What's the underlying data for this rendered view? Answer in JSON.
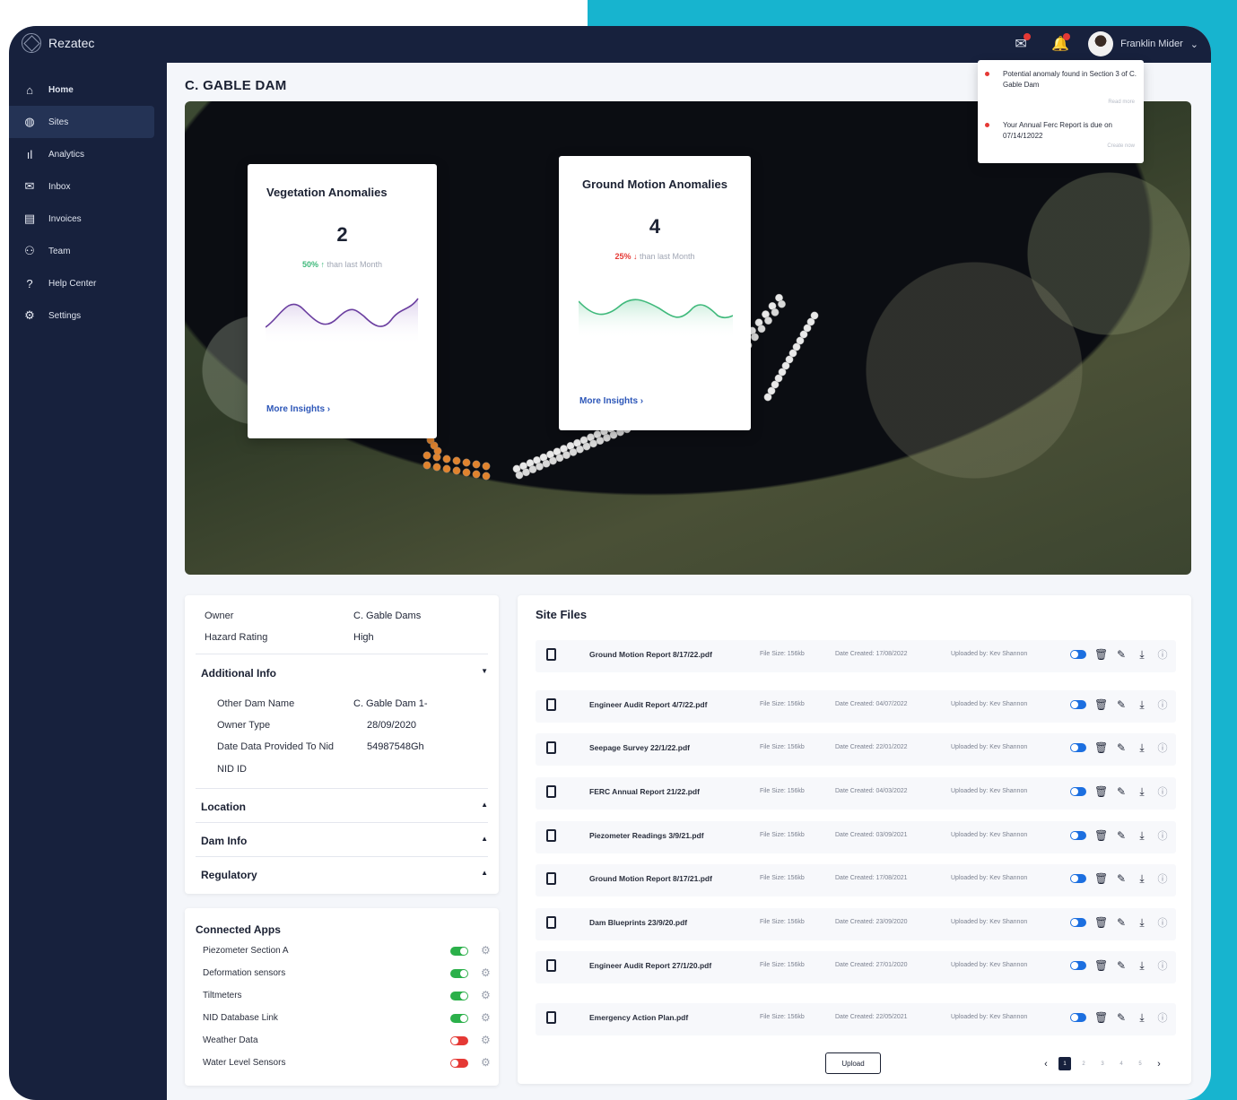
{
  "app": {
    "name": "Rezatec"
  },
  "user": {
    "name": "Franklin Mider"
  },
  "sidebar": {
    "items": [
      {
        "label": "Home",
        "icon": "home-icon"
      },
      {
        "label": "Sites",
        "icon": "globe-icon"
      },
      {
        "label": "Analytics",
        "icon": "analytics-icon"
      },
      {
        "label": "Inbox",
        "icon": "mail-icon"
      },
      {
        "label": "Invoices",
        "icon": "invoice-icon"
      },
      {
        "label": "Team",
        "icon": "team-icon"
      },
      {
        "label": "Help Center",
        "icon": "help-icon"
      },
      {
        "label": "Settings",
        "icon": "settings-icon"
      }
    ],
    "active": "Sites"
  },
  "page": {
    "title": "C. GABLE DAM"
  },
  "notifications": [
    {
      "text": "Potential anomaly found in Section 3 of C. Gable Dam",
      "action": "Read more"
    },
    {
      "text": "Your Annual Ferc Report is due on 07/14/12022",
      "action": "Create now"
    }
  ],
  "cards": {
    "vegetation": {
      "title": "Vegetation Anomalies",
      "value": "2",
      "delta": "50%",
      "delta_arrow": "↑",
      "delta_text": "than last Month",
      "link": "More Insights",
      "line_color": "#6b3fa0"
    },
    "ground": {
      "title": "Ground Motion Anomalies",
      "value": "4",
      "delta": "25%",
      "delta_arrow": "↓",
      "delta_text": "than last Month",
      "link": "More Insights",
      "line_color": "#3fb97b"
    }
  },
  "info": {
    "owner_label": "Owner",
    "owner": "C. Gable Dams",
    "hazard_label": "Hazard Rating",
    "hazard": "High",
    "additional_title": "Additional Info",
    "additional": [
      {
        "label": "Other Dam Name",
        "value": "C. Gable Dam 1-"
      },
      {
        "label": "Owner Type",
        "value": "28/09/2020"
      },
      {
        "label": "Date Data Provided To Nid",
        "value": "54987548Gh"
      },
      {
        "label": "NID ID",
        "value": ""
      }
    ],
    "sections": [
      "Location",
      "Dam Info",
      "Regulatory"
    ]
  },
  "connected_apps": {
    "title": "Connected Apps",
    "items": [
      {
        "name": "Piezometer Section A",
        "enabled": true
      },
      {
        "name": "Deformation sensors",
        "enabled": true
      },
      {
        "name": "Tiltmeters",
        "enabled": true
      },
      {
        "name": "NID Database Link",
        "enabled": true
      },
      {
        "name": "Weather Data",
        "enabled": false
      },
      {
        "name": "Water Level Sensors",
        "enabled": false
      }
    ]
  },
  "site_files": {
    "title": "Site Files",
    "files": [
      {
        "name": "Ground Motion Report 8/17/22.pdf",
        "size": "File Size: 156kb",
        "created": "Date Created: 17/08/2022",
        "uploaded": "Uploaded by: Kev Shannon"
      },
      {
        "name": "Engineer Audit Report 4/7/22.pdf",
        "size": "File Size: 156kb",
        "created": "Date Created: 04/07/2022",
        "uploaded": "Uploaded by: Kev Shannon"
      },
      {
        "name": "Seepage Survey 22/1/22.pdf",
        "size": "File Size: 156kb",
        "created": "Date Created: 22/01/2022",
        "uploaded": "Uploaded by: Kev Shannon"
      },
      {
        "name": "FERC Annual Report 21/22.pdf",
        "size": "File Size: 156kb",
        "created": "Date Created: 04/03/2022",
        "uploaded": "Uploaded by: Kev Shannon"
      },
      {
        "name": "Piezometer Readings 3/9/21.pdf",
        "size": "File Size: 156kb",
        "created": "Date Created: 03/09/2021",
        "uploaded": "Uploaded by: Kev Shannon"
      },
      {
        "name": "Ground Motion Report 8/17/21.pdf",
        "size": "File Size: 156kb",
        "created": "Date Created: 17/08/2021",
        "uploaded": "Uploaded by: Kev Shannon"
      },
      {
        "name": "Dam Blueprints 23/9/20.pdf",
        "size": "File Size: 156kb",
        "created": "Date Created: 23/09/2020",
        "uploaded": "Uploaded by: Kev Shannon"
      },
      {
        "name": "Engineer Audit Report 27/1/20.pdf",
        "size": "File Size: 156kb",
        "created": "Date Created: 27/01/2020",
        "uploaded": "Uploaded by: Kev Shannon"
      },
      {
        "name": "Emergency Action Plan.pdf",
        "size": "File Size: 156kb",
        "created": "Date Created: 22/05/2021",
        "uploaded": "Uploaded by: Kev Shannon"
      }
    ],
    "upload_label": "Upload",
    "pagination": {
      "current": "1",
      "pages": [
        "1",
        "2",
        "3",
        "4",
        "5"
      ]
    }
  },
  "colors": {
    "navy": "#17213d",
    "accent_cyan": "#17b4cf",
    "toggle_on": "#2bb04a",
    "toggle_off": "#e53935",
    "file_toggle": "#1c6fe0"
  }
}
